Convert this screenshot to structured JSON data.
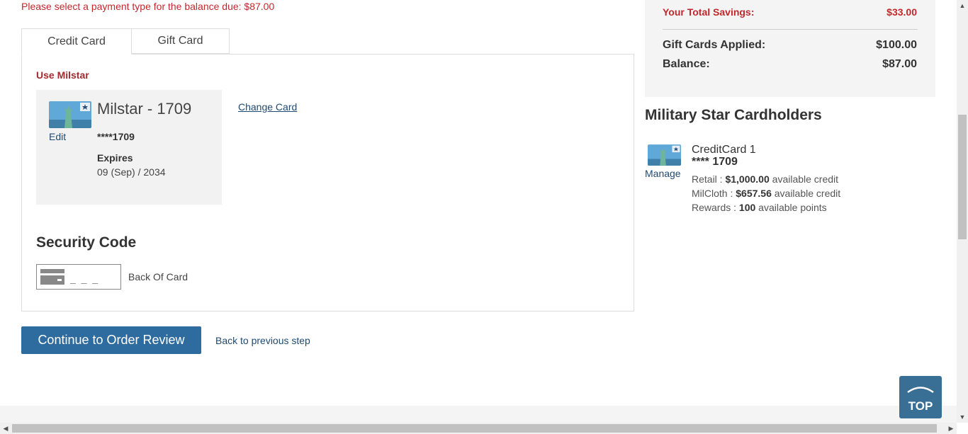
{
  "alert": "Please select a payment type for the balance due: $87.00",
  "tabs": {
    "credit": "Credit Card",
    "gift": "Gift Card"
  },
  "use_milstar": "Use Milstar",
  "card": {
    "title": "Milstar - 1709",
    "edit": "Edit",
    "masked": "****1709",
    "expires_label": "Expires",
    "expires_value": "09 (Sep) / 2034",
    "change": "Change Card"
  },
  "security": {
    "title": "Security Code",
    "placeholder": "_ _ _",
    "hint": "Back Of Card"
  },
  "actions": {
    "continue": "Continue to Order Review",
    "back": "Back to previous step"
  },
  "summary": {
    "savings_label": "Your Total Savings:",
    "savings_value": "$33.00",
    "gift_label": "Gift Cards Applied:",
    "gift_value": "$100.00",
    "balance_label": "Balance:",
    "balance_value": "$87.00"
  },
  "military": {
    "title": "Military Star Cardholders",
    "manage": "Manage",
    "card_name": "CreditCard 1",
    "card_num": "**** 1709",
    "lines": [
      {
        "label": "Retail :",
        "value": "$1,000.00",
        "suffix": "available credit"
      },
      {
        "label": "MilCloth :",
        "value": "$657.56",
        "suffix": "available credit"
      },
      {
        "label": "Rewards :",
        "value": "100",
        "suffix": "available points"
      }
    ]
  },
  "top_button": "TOP",
  "colors": {
    "alert": "#c0282d",
    "primary": "#2e6c9f",
    "link": "#1d4a73",
    "top": "#3a6f95"
  }
}
